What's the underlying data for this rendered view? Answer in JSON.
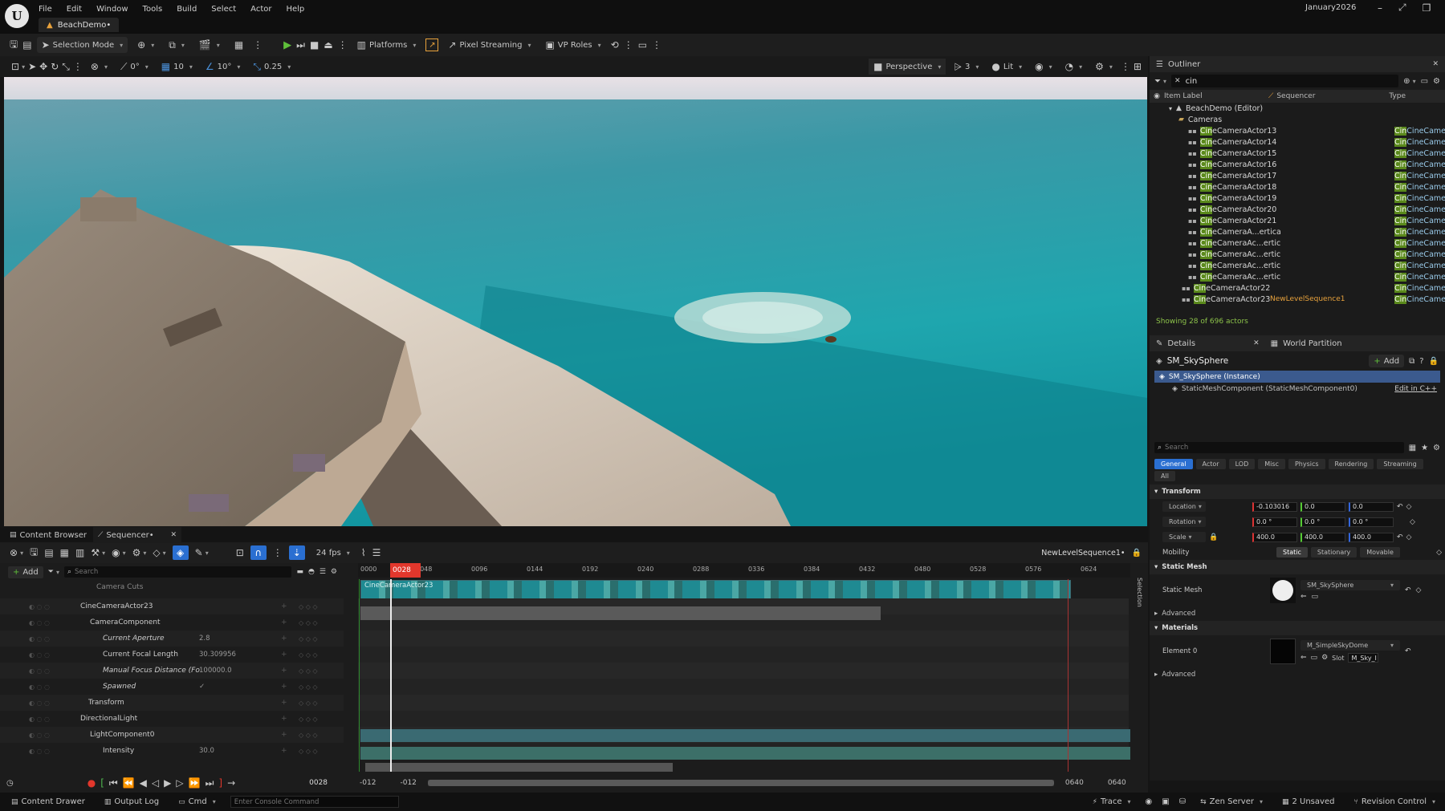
{
  "app": {
    "logo": "U",
    "menu": [
      "File",
      "Edit",
      "Window",
      "Tools",
      "Build",
      "Select",
      "Actor",
      "Help"
    ],
    "project_tab": "BeachDemo•",
    "window_title": "January2026"
  },
  "toolbar": {
    "selection_mode": "Selection Mode",
    "platforms": "Platforms",
    "pixel_streaming": "Pixel Streaming",
    "vp_roles": "VP Roles"
  },
  "viewport_toolbar": {
    "snap_rot": "0°",
    "snap_grid": "10",
    "snap_angle": "10°",
    "snap_scale": "0.25",
    "perspective": "Perspective",
    "cam_speed": "3",
    "lit": "Lit"
  },
  "outliner": {
    "tab": "Outliner",
    "search": "cin",
    "col_label": "Item Label",
    "col_sequencer": "Sequencer",
    "col_type": "Type",
    "root": "BeachDemo (Editor)",
    "folder": "Cameras",
    "items": [
      {
        "pre": "Cin",
        "rest": "eCameraActor13",
        "type": "CineCamera",
        "seq": ""
      },
      {
        "pre": "Cin",
        "rest": "eCameraActor14",
        "type": "CineCamera",
        "seq": ""
      },
      {
        "pre": "Cin",
        "rest": "eCameraActor15",
        "type": "CineCamera",
        "seq": ""
      },
      {
        "pre": "Cin",
        "rest": "eCameraActor16",
        "type": "CineCamera",
        "seq": ""
      },
      {
        "pre": "Cin",
        "rest": "eCameraActor17",
        "type": "CineCamera",
        "seq": ""
      },
      {
        "pre": "Cin",
        "rest": "eCameraActor18",
        "type": "CineCamera",
        "seq": ""
      },
      {
        "pre": "Cin",
        "rest": "eCameraActor19",
        "type": "CineCamera",
        "seq": ""
      },
      {
        "pre": "Cin",
        "rest": "eCameraActor20",
        "type": "CineCamera",
        "seq": ""
      },
      {
        "pre": "Cin",
        "rest": "eCameraActor21",
        "type": "CineCamera",
        "seq": ""
      },
      {
        "pre": "Cin",
        "rest": "eCameraA...ertica",
        "type": "CineCamera",
        "seq": ""
      },
      {
        "pre": "Cin",
        "rest": "eCameraAc...ertic",
        "type": "CineCamera",
        "seq": ""
      },
      {
        "pre": "Cin",
        "rest": "eCameraAc...ertic",
        "type": "CineCamera",
        "seq": ""
      },
      {
        "pre": "Cin",
        "rest": "eCameraAc...ertic",
        "type": "CineCamera",
        "seq": ""
      },
      {
        "pre": "Cin",
        "rest": "eCameraAc...ertic",
        "type": "CineCamera",
        "seq": ""
      },
      {
        "pre": "Cin",
        "rest": "eCameraActor22",
        "type": "CineCamera",
        "seq": ""
      },
      {
        "pre": "Cin",
        "rest": "eCameraActor23",
        "type": "CineCamera",
        "seq": "NewLevelSequence1"
      }
    ],
    "showing": "Showing 28 of 696 actors"
  },
  "details": {
    "tab": "Details",
    "tab2": "World Partition",
    "actor": "SM_SkySphere",
    "add": "Add",
    "instance": "SM_SkySphere (Instance)",
    "component": "StaticMeshComponent (StaticMeshComponent0)",
    "edit_cpp": "Edit in C++",
    "search_placeholder": "Search",
    "filters": [
      "General",
      "Actor",
      "LOD",
      "Misc",
      "Physics",
      "Rendering",
      "Streaming"
    ],
    "filter_all": "All",
    "transform": "Transform",
    "location": {
      "label": "Location",
      "x": "-0.103016",
      "y": "0.0",
      "z": "0.0"
    },
    "rotation": {
      "label": "Rotation",
      "x": "0.0 °",
      "y": "0.0 °",
      "z": "0.0 °"
    },
    "scale": {
      "label": "Scale",
      "x": "400.0",
      "y": "400.0",
      "z": "400.0"
    },
    "mobility": "Mobility",
    "mob_options": [
      "Static",
      "Stationary",
      "Movable"
    ],
    "static_mesh_section": "Static Mesh",
    "static_mesh_label": "Static Mesh",
    "static_mesh_value": "SM_SkySphere",
    "advanced": "Advanced",
    "materials": "Materials",
    "element0": "Element 0",
    "material_value": "M_SimpleSkyDome",
    "slot": "Slot",
    "slot_value": "M_Sky_I",
    "advanced2": "Advanced"
  },
  "bottom": {
    "tab_content": "Content Browser",
    "tab_seq": "Sequencer•",
    "add": "Add",
    "search_placeholder": "Search",
    "fps": "24 fps",
    "sequence_name": "NewLevelSequence1•",
    "current_frame": "0028",
    "range_start": "-012",
    "range_start2": "-012",
    "range_end": "0640",
    "range_end2": "0640",
    "selection": "Selection",
    "ruler": [
      "0000",
      "0048",
      "0096",
      "0144",
      "0192",
      "0240",
      "0288",
      "0336",
      "0384",
      "0432",
      "0480",
      "0528",
      "0576",
      "0624"
    ],
    "camera_cuts": "Camera Cuts",
    "clip_name": "CineCameraActor23",
    "tracks": [
      {
        "name": "CineCameraActor23",
        "value": ""
      },
      {
        "name": "CameraComponent",
        "value": ""
      },
      {
        "name": "Current Aperture",
        "value": "2.8"
      },
      {
        "name": "Current Focal Length",
        "value": "30.309956"
      },
      {
        "name": "Manual Focus Distance (Fo",
        "value": "100000.0"
      },
      {
        "name": "Spawned",
        "value": "✓"
      },
      {
        "name": "Transform",
        "value": ""
      },
      {
        "name": "DirectionalLight",
        "value": ""
      },
      {
        "name": "LightComponent0",
        "value": ""
      },
      {
        "name": "Intensity",
        "value": "30.0"
      }
    ]
  },
  "status": {
    "content_drawer": "Content Drawer",
    "output_log": "Output Log",
    "cmd": "Cmd",
    "console_placeholder": "Enter Console Command",
    "trace": "Trace",
    "zen": "Zen Server",
    "unsaved": "2 Unsaved",
    "revision": "Revision Control"
  }
}
